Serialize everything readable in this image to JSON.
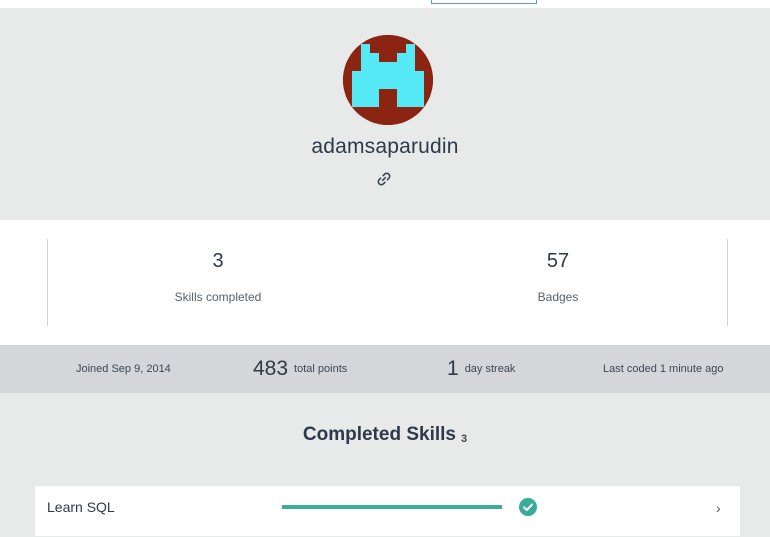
{
  "profile": {
    "username": "adamsaparudin"
  },
  "stats": {
    "skills_completed": {
      "value": "3",
      "label": "Skills completed"
    },
    "badges": {
      "value": "57",
      "label": "Badges"
    }
  },
  "info": {
    "joined": "Joined Sep 9, 2014",
    "points_value": "483",
    "points_label": "total points",
    "streak_value": "1",
    "streak_label": "day streak",
    "last_coded": "Last coded 1 minute ago"
  },
  "completed_skills": {
    "title": "Completed Skills",
    "count": "3",
    "items": [
      {
        "name": "Learn SQL",
        "progress": 1.0,
        "completed": true
      }
    ]
  },
  "colors": {
    "accent": "#3aac9c",
    "avatar_bg": "#8b2410",
    "avatar_fg": "#55e8f5",
    "info_bar": "#d4d6d9"
  }
}
